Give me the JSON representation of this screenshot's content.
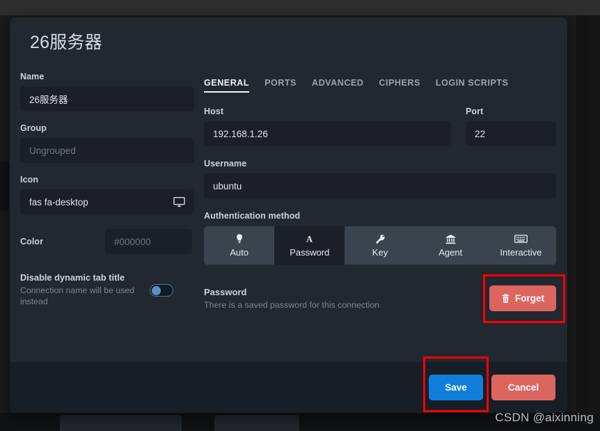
{
  "modal": {
    "title": "26服务器"
  },
  "left": {
    "name": {
      "label": "Name",
      "value": "26服务器"
    },
    "group": {
      "label": "Group",
      "placeholder": "Ungrouped",
      "value": ""
    },
    "icon": {
      "label": "Icon",
      "value": "fas fa-desktop",
      "glyph": "desktop-icon"
    },
    "color": {
      "label": "Color",
      "placeholder": "#000000",
      "value": ""
    },
    "toggle": {
      "title": "Disable dynamic tab title",
      "subtitle": "Connection name will be used instead",
      "state": "off"
    }
  },
  "right": {
    "tabs": [
      {
        "label": "GENERAL",
        "active": true
      },
      {
        "label": "PORTS",
        "active": false
      },
      {
        "label": "ADVANCED",
        "active": false
      },
      {
        "label": "CIPHERS",
        "active": false
      },
      {
        "label": "LOGIN SCRIPTS",
        "active": false
      }
    ],
    "host": {
      "label": "Host",
      "value": "192.168.1.26"
    },
    "port": {
      "label": "Port",
      "value": "22"
    },
    "username": {
      "label": "Username",
      "value": "ubuntu"
    },
    "auth": {
      "label": "Authentication method",
      "options": [
        {
          "label": "Auto",
          "icon": "lightbulb-icon",
          "selected": false
        },
        {
          "label": "Password",
          "icon": "letter-a-icon",
          "selected": true
        },
        {
          "label": "Key",
          "icon": "key-icon",
          "selected": false
        },
        {
          "label": "Agent",
          "icon": "bank-icon",
          "selected": false
        },
        {
          "label": "Interactive",
          "icon": "keyboard-icon",
          "selected": false
        }
      ]
    },
    "password": {
      "title": "Password",
      "subtitle": "There is a saved password for this connection",
      "forget_label": "Forget",
      "forget_icon": "trash-icon"
    }
  },
  "footer": {
    "save_label": "Save",
    "cancel_label": "Cancel"
  },
  "watermark": "CSDN @aixinning",
  "colors": {
    "accent_blue": "#0f7fdb",
    "danger_red": "#dc6560",
    "annotation_red": "#fe0000",
    "modal_bg": "#212830",
    "input_bg": "#1b2028"
  }
}
